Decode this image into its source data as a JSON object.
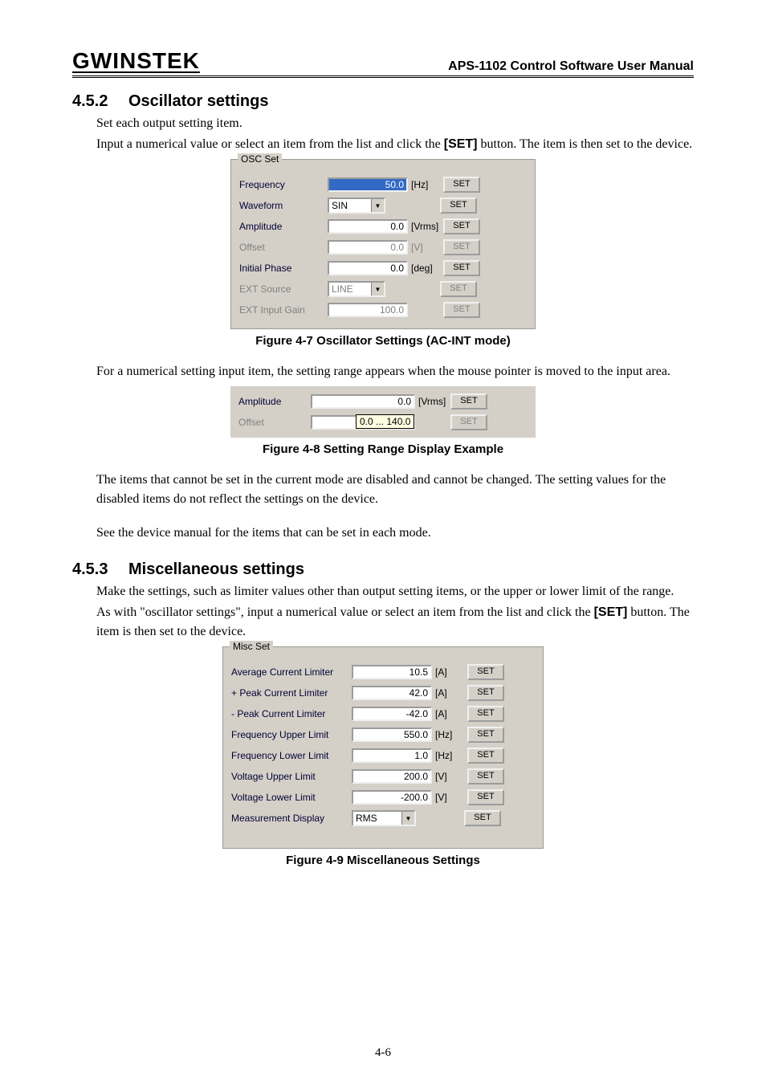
{
  "header": {
    "logo": "GWINSTEK",
    "manual": "APS-1102 Control Software User Manual"
  },
  "section452": {
    "num": "4.5.2",
    "title": "Oscillator settings",
    "p1": "Set each output setting item.",
    "p2a": "Input a numerical value or select an item from the list and click the ",
    "p2b": "[SET]",
    "p2c": " button. The item is then set to the device."
  },
  "fig47": {
    "caption": "Figure 4-7  Oscillator Settings (AC-INT mode)",
    "group": "OSC Set",
    "rows": [
      {
        "label": "Frequency",
        "type": "text",
        "value": "50.0",
        "selected": true,
        "unit": "[Hz]",
        "btn": "SET",
        "enabled": true
      },
      {
        "label": "Waveform",
        "type": "combo",
        "value": "SIN",
        "unit": "",
        "btn": "SET",
        "enabled": true
      },
      {
        "label": "Amplitude",
        "type": "text",
        "value": "0.0",
        "unit": "[Vrms]",
        "btn": "SET",
        "enabled": true
      },
      {
        "label": "Offset",
        "type": "text",
        "value": "0.0",
        "unit": "[V]",
        "btn": "SET",
        "enabled": false
      },
      {
        "label": "Initial Phase",
        "type": "text",
        "value": "0.0",
        "unit": "[deg]",
        "btn": "SET",
        "enabled": true
      },
      {
        "label": "EXT Source",
        "type": "combo",
        "value": "LINE",
        "unit": "",
        "btn": "SET",
        "enabled": false
      },
      {
        "label": "EXT Input Gain",
        "type": "text",
        "value": "100.0",
        "unit": "",
        "btn": "SET",
        "enabled": false
      }
    ]
  },
  "mid_para": "For a numerical setting input item, the setting range appears when the mouse pointer is moved to the input area.",
  "fig48": {
    "caption": "Figure 4-8  Setting Range Display Example",
    "amp_label": "Amplitude",
    "amp_value": "0.0",
    "amp_unit": "[Vrms]",
    "amp_btn": "SET",
    "off_label": "Offset",
    "off_btn": "SET",
    "tooltip": "0.0 ... 140.0"
  },
  "after48_p1": "The items that cannot be set in the current mode are disabled and cannot be changed. The setting values for the disabled items do not reflect the settings on the device.",
  "after48_p2": "See the device manual for the items that can be set in each mode.",
  "section453": {
    "num": "4.5.3",
    "title": "Miscellaneous settings",
    "p1": "Make the settings, such as limiter values other than output setting items, or the upper or lower limit of the range.",
    "p2a": "As with \"oscillator settings\", input a numerical value or select an item from the list and click the ",
    "p2b": "[SET]",
    "p2c": " button. The item is then set to the device."
  },
  "fig49": {
    "caption": "Figure 4-9  Miscellaneous Settings",
    "group": "Misc Set",
    "rows": [
      {
        "label": "Average Current Limiter",
        "type": "text",
        "value": "10.5",
        "unit": "[A]",
        "btn": "SET"
      },
      {
        "label": "+ Peak Current Limiter",
        "type": "text",
        "value": "42.0",
        "unit": "[A]",
        "btn": "SET"
      },
      {
        "label": "- Peak Current Limiter",
        "type": "text",
        "value": "-42.0",
        "unit": "[A]",
        "btn": "SET"
      },
      {
        "label": "Frequency Upper Limit",
        "type": "text",
        "value": "550.0",
        "unit": "[Hz]",
        "btn": "SET"
      },
      {
        "label": "Frequency Lower Limit",
        "type": "text",
        "value": "1.0",
        "unit": "[Hz]",
        "btn": "SET"
      },
      {
        "label": "Voltage Upper Limit",
        "type": "text",
        "value": "200.0",
        "unit": "[V]",
        "btn": "SET"
      },
      {
        "label": "Voltage Lower Limit",
        "type": "text",
        "value": "-200.0",
        "unit": "[V]",
        "btn": "SET"
      },
      {
        "label": "Measurement Display",
        "type": "combo",
        "value": "RMS",
        "unit": "",
        "btn": "SET"
      }
    ]
  },
  "pagenum": "4-6"
}
